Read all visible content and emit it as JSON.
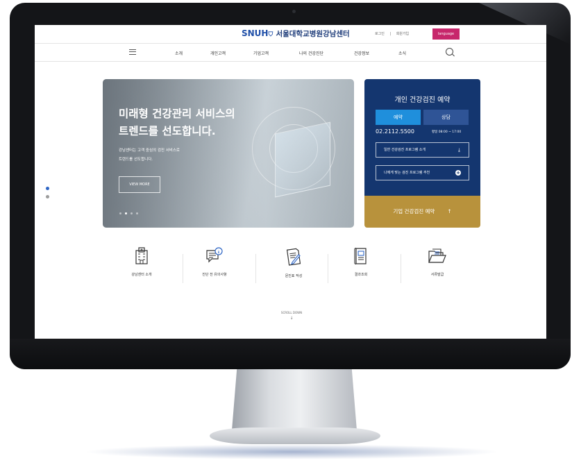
{
  "header": {
    "logo_brand": "SNUH",
    "logo_text": "서울대학교병원강남센터",
    "util_links": [
      "로그인",
      "|",
      "회원가입"
    ],
    "language_label": "language"
  },
  "nav": {
    "items": [
      "소개",
      "개인고객",
      "기업고객",
      "나의 건강진단",
      "건강정보",
      "소식"
    ]
  },
  "hero": {
    "title_line1": "미래형 건강관리 서비스의",
    "title_line2": "트렌드를 선도합니다.",
    "sub_line1": "강남센터는 고객 중심의 검진 서비스로",
    "sub_line2": "트렌드를 선도합니다.",
    "button_label": "VIEW MORE"
  },
  "reservation": {
    "title": "개인 건강검진 예약",
    "tab_reserve": "예약",
    "tab_consult": "상담",
    "phone": "02.2112.5500",
    "hours": "평일 08:00 ~ 17:00",
    "program_intro": "일반 건강검진 프로그램 소개",
    "program_recommend": "나에게 맞는 검진 프로그램 추천",
    "corporate": "기업 건강검진 예약"
  },
  "quick_links": [
    {
      "label": "강남센터 소개",
      "icon": "building-icon"
    },
    {
      "label": "진단 전 유의사항",
      "icon": "info-chat-icon"
    },
    {
      "label": "문진표 작성",
      "icon": "document-pen-icon"
    },
    {
      "label": "결과조회",
      "icon": "result-scroll-icon"
    },
    {
      "label": "서류발급",
      "icon": "folder-document-icon"
    }
  ],
  "scroll_down": "SCROLL DOWN",
  "colors": {
    "brand_navy": "#14366f",
    "tab_blue": "#1f8fdc",
    "gold": "#b8923c",
    "language_pink": "#c7276b"
  }
}
